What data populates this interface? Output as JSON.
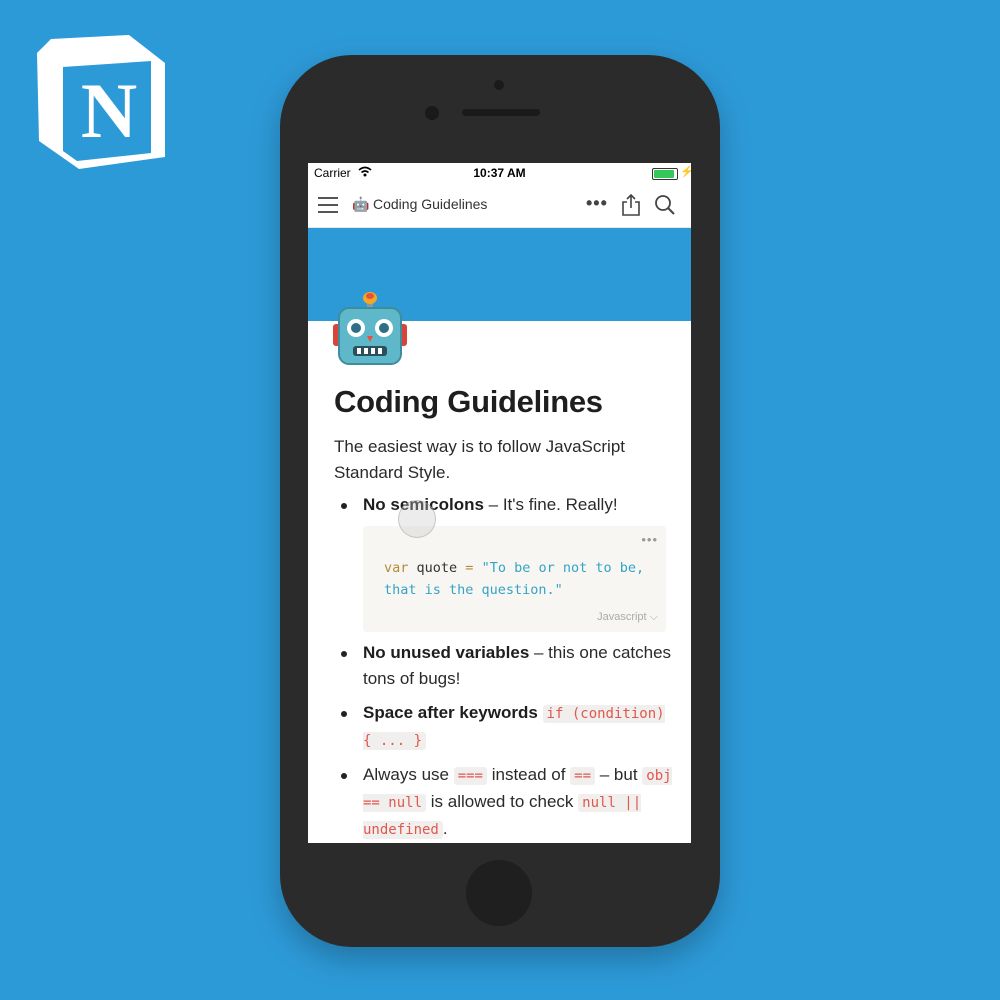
{
  "status_bar": {
    "carrier": "Carrier",
    "time": "10:37 AM",
    "battery_level": 1.0
  },
  "nav": {
    "page_emoji": "🤖",
    "page_title": "Coding Guidelines",
    "more_icon": "more-dots-icon",
    "share_icon": "share-icon",
    "search_icon": "search-icon"
  },
  "page": {
    "icon": "robot-icon",
    "title": "Coding Guidelines",
    "intro": "The easiest way is to follow JavaScript Standard Style.",
    "bullets": [
      {
        "bold": "No semicolons",
        "text": " – It's fine. Really!"
      },
      {
        "bold": "No unused variables",
        "text": " – this one catches tons of bugs!"
      },
      {
        "bold": "Space after keywords",
        "code": "if (condition) { ... }"
      },
      {
        "pre": "Always use ",
        "code1": "===",
        "mid": " instead of ",
        "code2": "==",
        "after": " – but ",
        "code3": "obj == null",
        "mid2": " is allowed to check ",
        "code4": "null || undefined",
        "end": "."
      }
    ],
    "code_block": {
      "keyword": "var",
      "identifier": " quote ",
      "operator": "=",
      "string": " \"To be or not to be, that is the question.\"",
      "language": "Javascript ⌵"
    }
  },
  "colors": {
    "background": "#2d9ad8",
    "cover": "#2d9ad8",
    "phone": "#2b2b2b",
    "inline_code": "#e0574e"
  }
}
